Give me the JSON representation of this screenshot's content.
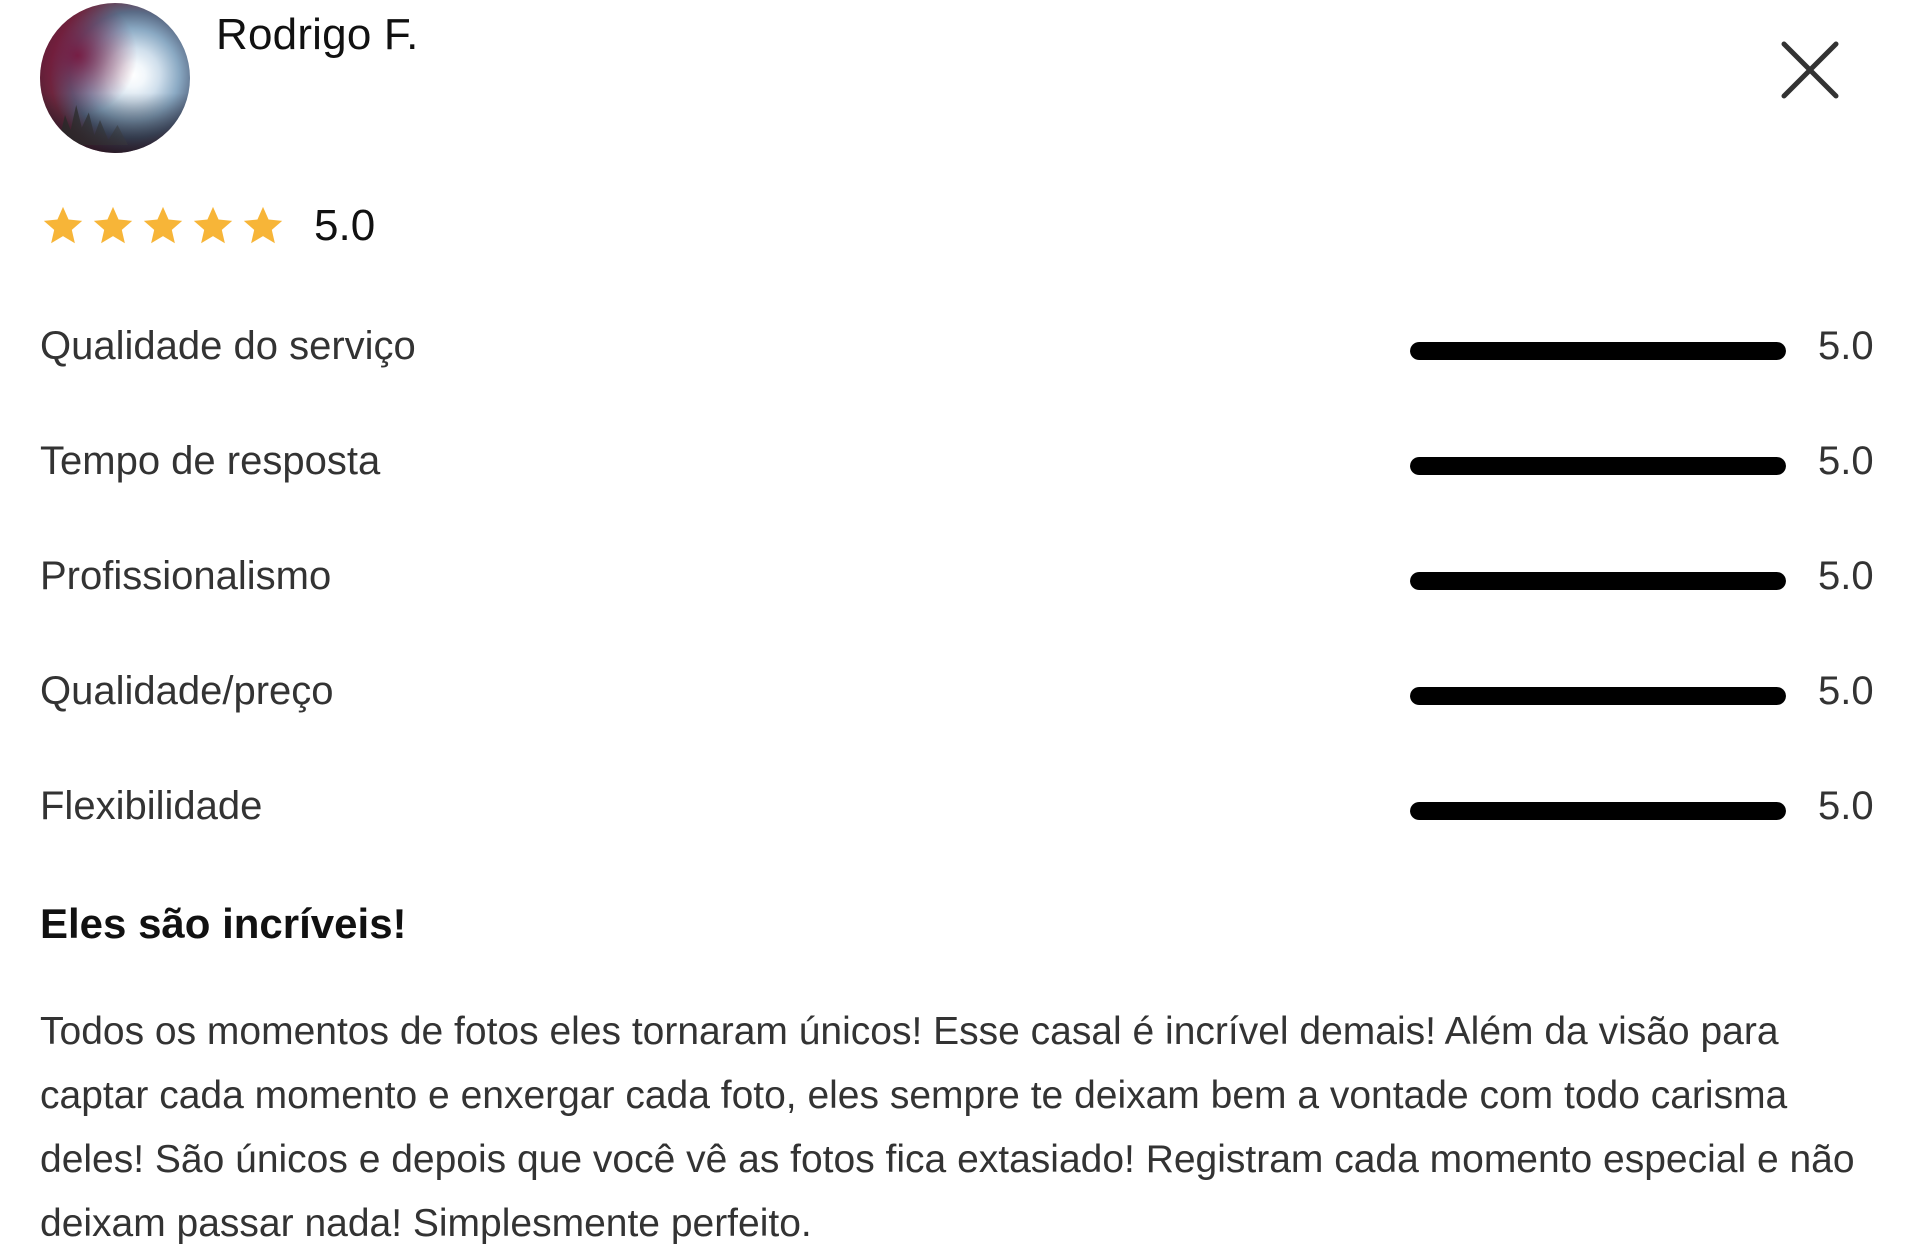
{
  "review": {
    "author": {
      "name": "Rodrigo F.",
      "avatar_icon": "user-avatar-photo"
    },
    "close_icon": "close-icon",
    "overall": {
      "stars": 5,
      "max_stars": 5,
      "score": "5.0",
      "star_color": "#F7B538"
    },
    "categories": [
      {
        "label": "Qualidade do serviço",
        "score": "5.0",
        "fraction": 1.0
      },
      {
        "label": "Tempo de resposta",
        "score": "5.0",
        "fraction": 1.0
      },
      {
        "label": "Profissionalismo",
        "score": "5.0",
        "fraction": 1.0
      },
      {
        "label": "Qualidade/preço",
        "score": "5.0",
        "fraction": 1.0
      },
      {
        "label": "Flexibilidade",
        "score": "5.0",
        "fraction": 1.0
      }
    ],
    "title": "Eles são incríveis!",
    "body": "Todos os momentos de fotos eles tornaram únicos! Esse casal é incrível demais! Além da visão para captar cada momento e enxergar cada foto, eles sempre te deixam bem a vontade com todo carisma deles! São únicos e depois que você vê as fotos fica extasiado! Registram cada momento especial e não deixam passar nada! Simplesmente perfeito."
  }
}
